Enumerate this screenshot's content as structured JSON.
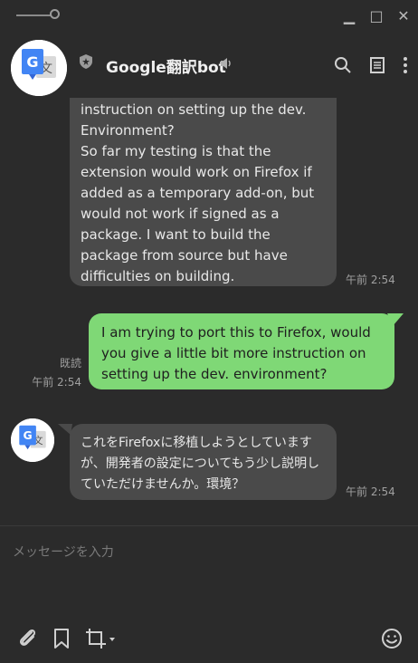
{
  "window": {
    "minimize_glyph": "▁",
    "maximize_glyph": "□",
    "close_glyph": "✕"
  },
  "header": {
    "title": "Google翻訳bot"
  },
  "messages": [
    {
      "side": "in",
      "text": "instruction on setting up the dev. Environment?\nSo far my testing is that the extension would work on Firefox if added as a temporary add-on, but would not work if signed as a package. I want to build the package from source but have difficulties on building.",
      "time": "午前 2:54"
    },
    {
      "side": "out",
      "text": "I am trying to port this to Firefox, would you give a little bit more instruction on setting up the dev. environment?",
      "read": "既読",
      "time": "午前 2:54"
    },
    {
      "side": "in",
      "text": "これをFirefoxに移植しようとしていますが、開発者の設定についてもう少し説明していただけませんか。環境？",
      "time": "午前 2:54"
    }
  ],
  "composer": {
    "placeholder": "メッセージを入力"
  },
  "colors": {
    "background": "#2b2b2b",
    "bubble_in": "#4a4a4a",
    "bubble_out": "#7fd876",
    "google_blue": "#4285f4"
  },
  "icons": [
    "shield-icon",
    "speaker-icon",
    "search-icon",
    "notes-icon",
    "more-icon",
    "attachment-icon",
    "bookmark-icon",
    "crop-icon",
    "emoji-icon"
  ]
}
